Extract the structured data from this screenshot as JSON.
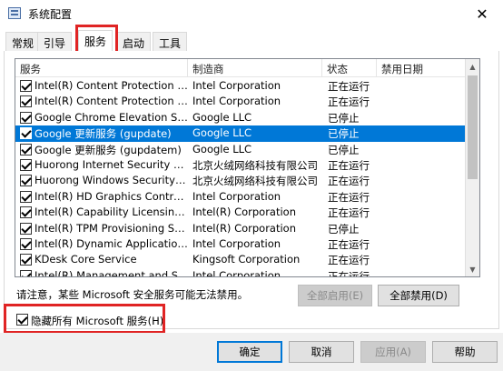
{
  "window": {
    "title": "系统配置",
    "close_glyph": "✕"
  },
  "tabs": [
    {
      "label": "常规",
      "active": false
    },
    {
      "label": "引导",
      "active": false
    },
    {
      "label": "服务",
      "active": true
    },
    {
      "label": "启动",
      "active": false
    },
    {
      "label": "工具",
      "active": false
    }
  ],
  "columns": {
    "service": "服务",
    "manufacturer": "制造商",
    "status": "状态",
    "disabled_date": "禁用日期"
  },
  "services": [
    {
      "name": "Intel(R) Content Protection HECI ...",
      "manufacturer": "Intel Corporation",
      "status": "正在运行",
      "checked": true,
      "selected": false
    },
    {
      "name": "Intel(R) Content Protection HDCP...",
      "manufacturer": "Intel Corporation",
      "status": "正在运行",
      "checked": true,
      "selected": false
    },
    {
      "name": "Google Chrome Elevation Servic...",
      "manufacturer": "Google LLC",
      "status": "已停止",
      "checked": true,
      "selected": false
    },
    {
      "name": "Google 更新服务 (gupdate)",
      "manufacturer": "Google LLC",
      "status": "已停止",
      "checked": true,
      "selected": true
    },
    {
      "name": "Google 更新服务 (gupdatem)",
      "manufacturer": "Google LLC",
      "status": "已停止",
      "checked": true,
      "selected": false
    },
    {
      "name": "Huorong Internet Security Daem...",
      "manufacturer": "北京火绒网络科技有限公司",
      "status": "正在运行",
      "checked": true,
      "selected": false
    },
    {
      "name": "Huorong Windows Security Center",
      "manufacturer": "北京火绒网络科技有限公司",
      "status": "正在运行",
      "checked": true,
      "selected": false
    },
    {
      "name": "Intel(R) HD Graphics Control Pan...",
      "manufacturer": "Intel Corporation",
      "status": "正在运行",
      "checked": true,
      "selected": false
    },
    {
      "name": "Intel(R) Capability Licensing Servi...",
      "manufacturer": "Intel(R) Corporation",
      "status": "正在运行",
      "checked": true,
      "selected": false
    },
    {
      "name": "Intel(R) TPM Provisioning Service",
      "manufacturer": "Intel(R) Corporation",
      "status": "已停止",
      "checked": true,
      "selected": false
    },
    {
      "name": "Intel(R) Dynamic Application Loa...",
      "manufacturer": "Intel Corporation",
      "status": "正在运行",
      "checked": true,
      "selected": false
    },
    {
      "name": "KDesk Core Service",
      "manufacturer": "Kingsoft Corporation",
      "status": "正在运行",
      "checked": true,
      "selected": false
    },
    {
      "name": "Intel(R) Management and Securit...",
      "manufacturer": "Intel Corporation",
      "status": "正在运行",
      "checked": true,
      "selected": false
    }
  ],
  "notice": "请注意，某些 Microsoft 安全服务可能无法禁用。",
  "buttons": {
    "enable_all": "全部启用(E)",
    "disable_all": "全部禁用(D)",
    "ok": "确定",
    "cancel": "取消",
    "apply": "应用(A)",
    "help": "帮助"
  },
  "hide_microsoft": {
    "label": "隐藏所有 Microsoft 服务(H)",
    "checked": true
  }
}
